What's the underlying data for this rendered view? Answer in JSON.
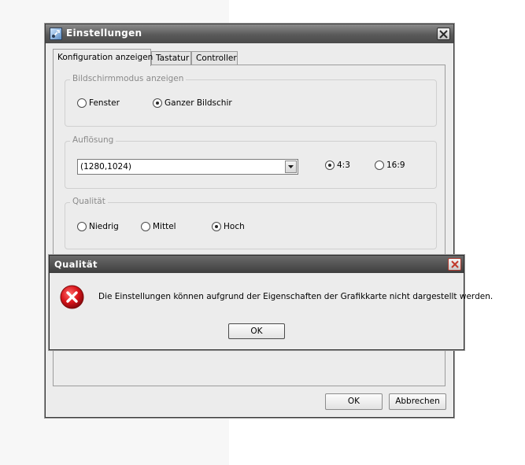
{
  "window": {
    "title": "Einstellungen",
    "icon": "settings-app-icon",
    "close_icon": "close-icon"
  },
  "tabs": [
    {
      "label": "Konfiguration anzeigen",
      "active": true
    },
    {
      "label": "Tastatur",
      "active": false
    },
    {
      "label": "Controller",
      "active": false
    }
  ],
  "display_mode": {
    "legend": "Bildschirmmodus anzeigen",
    "options": [
      {
        "label": "Fenster",
        "checked": false
      },
      {
        "label": "Ganzer Bildschir",
        "checked": true
      }
    ]
  },
  "resolution": {
    "legend": "Auflösung",
    "selected": "(1280,1024)",
    "aspect_options": [
      {
        "label": "4:3",
        "checked": true
      },
      {
        "label": "16:9",
        "checked": false
      }
    ]
  },
  "quality": {
    "legend": "Qualität",
    "options": [
      {
        "label": "Niedrig",
        "checked": false
      },
      {
        "label": "Mittel",
        "checked": false
      },
      {
        "label": "Hoch",
        "checked": true
      }
    ]
  },
  "footer": {
    "ok_label": "OK",
    "cancel_label": "Abbrechen"
  },
  "message_box": {
    "title": "Qualität",
    "icon": "error-icon",
    "text": "Die Einstellungen können aufgrund der Eigenschaften der Grafikkarte nicht dargestellt werden.",
    "ok_label": "OK"
  },
  "colors": {
    "titlebar": "#5a5a5a",
    "error_red": "#d8141a"
  }
}
